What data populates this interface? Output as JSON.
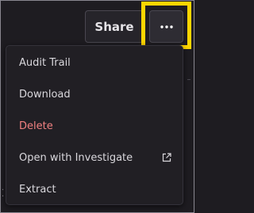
{
  "toolbar": {
    "share_label": "Share",
    "more_icon": "more-horizontal-icon"
  },
  "menu": {
    "items": [
      {
        "label": "Audit Trail"
      },
      {
        "label": "Download"
      },
      {
        "label": "Delete",
        "style": "danger"
      },
      {
        "label": "Open with Investigate",
        "icon": "external-link-icon"
      },
      {
        "label": "Extract"
      }
    ]
  },
  "colors": {
    "background": "#1e1c21",
    "menu_background": "#211f24",
    "danger": "#f08080",
    "highlight": "#ffd600"
  }
}
